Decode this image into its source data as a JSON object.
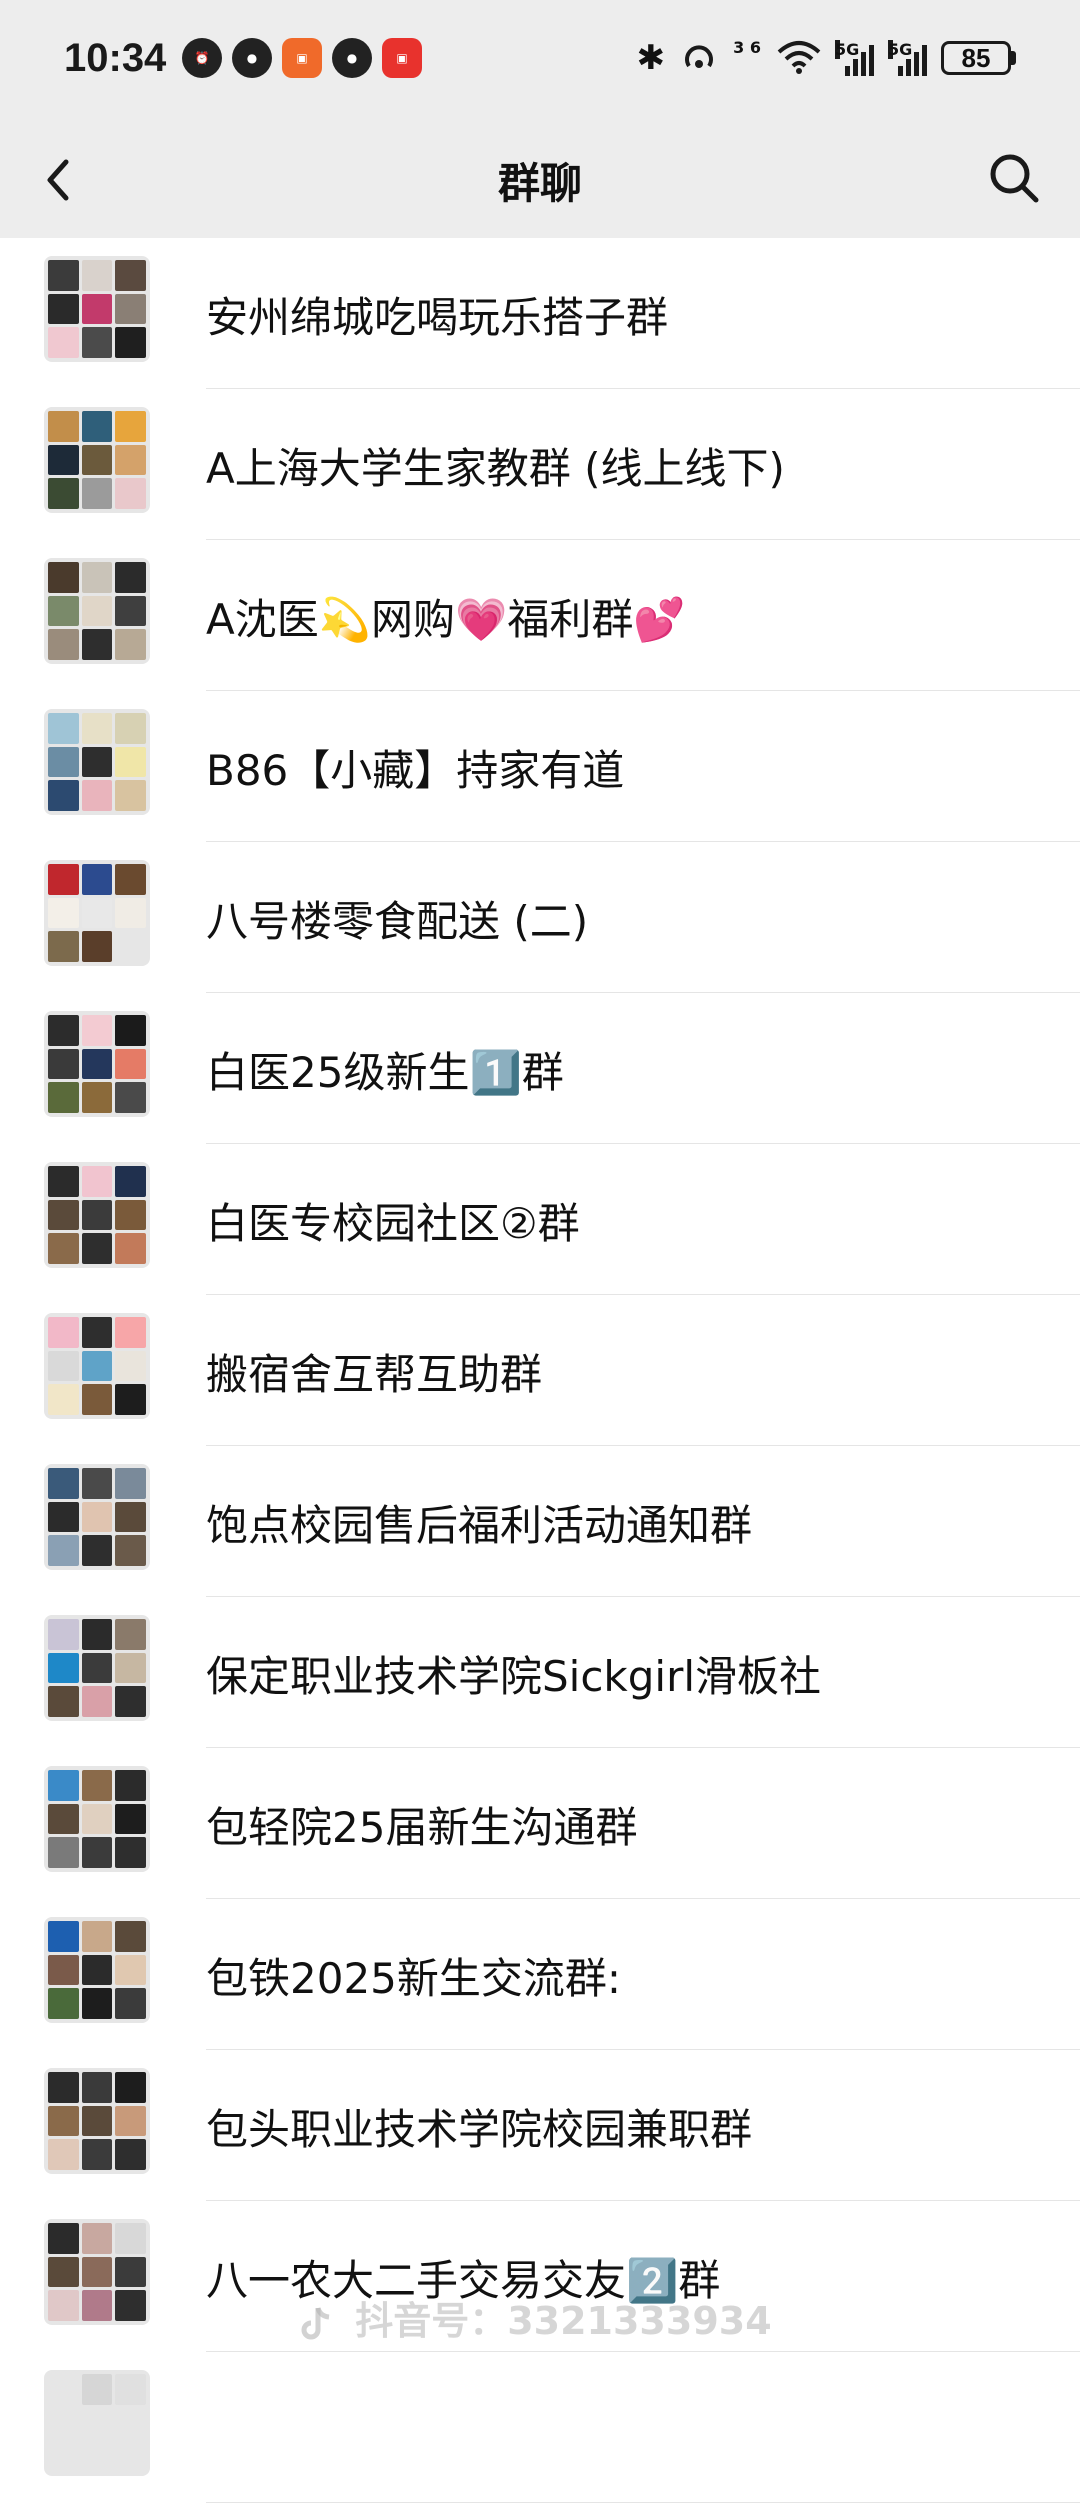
{
  "status_bar": {
    "time": "10:34",
    "network_1": "5G",
    "network_2": "5G",
    "data_tag": "3 6",
    "battery": "85"
  },
  "nav": {
    "title": "群聊",
    "back_icon": "chevron-left-icon",
    "search_icon": "search-icon"
  },
  "groups": [
    {
      "name": "安州绵城吃喝玩乐搭子群",
      "colors": [
        "#3b3b3b",
        "#d9d2cc",
        "#5a4a3f",
        "#2a2a2a",
        "#c23a6b",
        "#8a7f75",
        "#f0c8d0",
        "#4b4b4b",
        "#1f1f1f"
      ]
    },
    {
      "name": "A上海大学生家教群 (线上线下)",
      "colors": [
        "#c28e4a",
        "#2f5f7a",
        "#e7a53c",
        "#1d2a38",
        "#6b5a3c",
        "#d4a26a",
        "#3b4b33",
        "#9b9b9b",
        "#e9c8cb"
      ]
    },
    {
      "name": "A沈医💫网购💗福利群💕",
      "colors": [
        "#4a3a2c",
        "#c9c3b8",
        "#2b2b2b",
        "#7a8a6a",
        "#e0d6c8",
        "#3f3f3f",
        "#9a8c7c",
        "#2e2e2e",
        "#b7a995"
      ]
    },
    {
      "name": "B86【小藏】持家有道",
      "colors": [
        "#9fc4d6",
        "#e7e0c7",
        "#d7d1b3",
        "#6b8da4",
        "#2e2e2e",
        "#f0e6a8",
        "#2c4a70",
        "#e9b4bc",
        "#d8c3a0"
      ]
    },
    {
      "name": "八号楼零食配送 (二)",
      "colors": [
        "#c0272d",
        "#2c4b8f",
        "#6a4a2f",
        "#f3efe8",
        "#e8e8e8",
        "#f0ece5",
        "#7c6a4c",
        "#5a3e2a",
        "#e6e6e6"
      ]
    },
    {
      "name": "白医25级新生1️⃣群",
      "colors": [
        "#2c2c2c",
        "#f3cbd2",
        "#1b1b1b",
        "#3a3a3a",
        "#24375c",
        "#e57b66",
        "#5a6a3a",
        "#8b6a3a",
        "#4a4a4a"
      ]
    },
    {
      "name": "白医专校园社区②群",
      "colors": [
        "#2b2b2b",
        "#f1c4cf",
        "#20304e",
        "#5a4a3a",
        "#3b3b3b",
        "#7a5a3a",
        "#8a6a4a",
        "#2e2e2e",
        "#c27a5a"
      ]
    },
    {
      "name": "搬宿舍互帮互助群",
      "colors": [
        "#f2b8c8",
        "#2e2e2e",
        "#f7a6a8",
        "#d9d9d9",
        "#5fa3c8",
        "#e9e4dc",
        "#f1e6c8",
        "#7a5a3a",
        "#1d1d1d"
      ]
    },
    {
      "name": "饱点校园售后福利活动通知群",
      "colors": [
        "#3a5a7a",
        "#4a4a4a",
        "#7a8a9a",
        "#2b2b2b",
        "#e0c4b0",
        "#5a4a3a",
        "#8aa0b4",
        "#2e2e2e",
        "#6a5a4a"
      ]
    },
    {
      "name": "保定职业技术学院Sickgirl滑板社",
      "colors": [
        "#c9c4d6",
        "#2b2b2b",
        "#8a7a6a",
        "#1e88c8",
        "#3b3b3b",
        "#c6b7a2",
        "#5a4a3a",
        "#d9a0a8",
        "#2e2e2e"
      ]
    },
    {
      "name": "包轻院25届新生沟通群",
      "colors": [
        "#3a8ac8",
        "#8a6a4a",
        "#2b2b2b",
        "#5a4a3a",
        "#e0d0c0",
        "#1d1d1d",
        "#7a7a7a",
        "#3b3b3b",
        "#2e2e2e"
      ]
    },
    {
      "name": "包铁2025新生交流群:",
      "colors": [
        "#1d5fb0",
        "#c8a88a",
        "#5a4a3a",
        "#7a5a4a",
        "#2b2b2b",
        "#e0c8b0",
        "#4a6a3a",
        "#1d1d1d",
        "#3b3b3b"
      ]
    },
    {
      "name": "包头职业技术学院校园兼职群",
      "colors": [
        "#2b2b2b",
        "#3a3a3a",
        "#1d1d1d",
        "#8a6a4a",
        "#5a4a3a",
        "#c89a7a",
        "#e0c8b8",
        "#3b3b3b",
        "#2e2e2e"
      ]
    },
    {
      "name": "八一农大二手交易交友2️⃣群",
      "colors": [
        "#2b2b2b",
        "#c8a8a0",
        "#d8d8d8",
        "#5a4a3a",
        "#8a6a5a",
        "#3b3b3b",
        "#e0c8c8",
        "#b07a8a",
        "#2e2e2e"
      ]
    },
    {
      "name": "",
      "colors": [
        "#e6e6e6",
        "#d6d6d6",
        "#e0e0e0",
        "#e6e6e6",
        "#e6e6e6",
        "#e6e6e6",
        "#e6e6e6",
        "#e6e6e6",
        "#e6e6e6"
      ]
    }
  ],
  "watermark": "抖音号：3321333934"
}
